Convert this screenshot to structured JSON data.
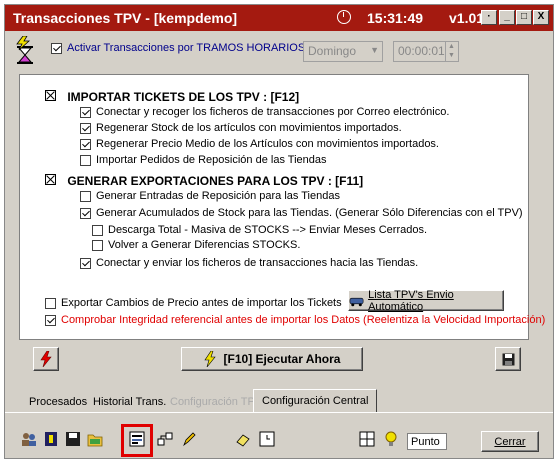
{
  "window": {
    "title": "Transacciones TPV - [kempdemo]",
    "time": "15:31:49",
    "version": "v1.01",
    "controls": [
      "·",
      "_",
      "□",
      "X"
    ]
  },
  "tramos": {
    "label": "Activar Transacciones por TRAMOS HORARIOS",
    "checked": true,
    "day": "Domingo",
    "time": "00:00:01"
  },
  "import_section": {
    "title": "IMPORTAR TICKETS DE LOS TPV : [F12]",
    "items": [
      {
        "label": "Conectar y recoger los ficheros de transacciones por Correo electrónico.",
        "checked": true
      },
      {
        "label": "Regenerar Stock de los artículos con movimientos importados.",
        "checked": true
      },
      {
        "label": "Regenerar Precio Medio de los Artículos con movimientos importados.",
        "checked": true
      },
      {
        "label": "Importar Pedidos de Reposición de las Tiendas",
        "checked": false
      }
    ]
  },
  "export_section": {
    "title": "GENERAR  EXPORTACIONES PARA LOS TPV : [F11]",
    "items": [
      {
        "label": "Generar Entradas de Reposición para las Tiendas",
        "checked": false
      },
      {
        "label": "Generar Acumulados de Stock para las Tiendas. (Generar Sólo Diferencias con el TPV)",
        "checked": true
      }
    ],
    "sub_items": [
      {
        "label": "Descarga Total - Masiva de STOCKS --> Enviar Meses Cerrados.",
        "checked": false
      },
      {
        "label": "Volver a Generar Diferencias STOCKS.",
        "checked": false
      }
    ],
    "send": {
      "label": "Conectar y enviar los ficheros de transacciones hacia las Tiendas.",
      "checked": true
    }
  },
  "options": {
    "export_prices": {
      "label": "Exportar Cambios de Precio antes de importar los Tickets",
      "checked": false
    },
    "integrity": {
      "label": "Comprobar Integridad referencial antes de importar los Datos  (Reelentiza la Velocidad Importación)",
      "checked": true
    },
    "lista_button": "Lista TPV's Envio Automático"
  },
  "execute_button": "[F10] Ejecutar Ahora",
  "tabs": [
    {
      "label": "Procesados",
      "state": "normal"
    },
    {
      "label": "Historial Trans.",
      "state": "normal"
    },
    {
      "label": "Configuración TPV",
      "state": "disabled"
    },
    {
      "label": "Configuración Central",
      "state": "active"
    }
  ],
  "toolbar": {
    "icons": [
      "users-icon",
      "key-icon",
      "save-icon",
      "folder-icon",
      "form-icon",
      "network-icon",
      "pen-icon",
      "eraser-icon",
      "clock-icon",
      "grid-icon",
      "bulb-icon"
    ],
    "punto_value": "Punto",
    "cerrar_label": "Cerrar"
  },
  "colors": {
    "titlebar": "#a41a10",
    "panel_bg": "#d4d0c8",
    "warning_text": "#e00000",
    "link_text": "#00008b"
  }
}
